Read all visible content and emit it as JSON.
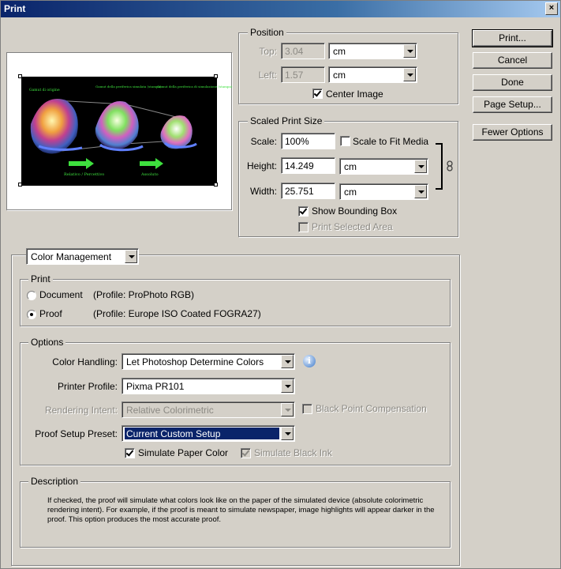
{
  "window": {
    "title": "Print",
    "close_glyph": "×"
  },
  "position": {
    "legend": "Position",
    "top_label": "Top:",
    "top_value": "3.04",
    "top_unit": "cm",
    "left_label": "Left:",
    "left_value": "1.57",
    "left_unit": "cm",
    "center_image_label": "Center Image",
    "center_image_checked": true
  },
  "scaled": {
    "legend": "Scaled Print Size",
    "scale_label": "Scale:",
    "scale_value": "100%",
    "scale_to_fit_label": "Scale to Fit Media",
    "scale_to_fit_checked": false,
    "height_label": "Height:",
    "height_value": "14.249",
    "height_unit": "cm",
    "width_label": "Width:",
    "width_value": "25.751",
    "width_unit": "cm",
    "show_bbox_label": "Show Bounding Box",
    "show_bbox_checked": true,
    "print_selected_label": "Print Selected Area",
    "print_selected_checked": false
  },
  "buttons": {
    "print": "Print...",
    "cancel": "Cancel",
    "done": "Done",
    "page_setup": "Page Setup...",
    "fewer_options": "Fewer Options"
  },
  "preview": {
    "caption_left": "Gamut di origine",
    "caption_mid": "Gamut della periferica simulata (stampa)",
    "caption_right": "Gamut della periferica di simulazione (stampa)",
    "label_relative": "Relativo / Percettivo",
    "label_absolute": "Assoluto"
  },
  "mode_select": "Color Management",
  "print_group": {
    "legend": "Print",
    "document_label": "Document",
    "document_profile": "(Profile: ProPhoto RGB)",
    "proof_label": "Proof",
    "proof_profile": "(Profile: Europe ISO Coated FOGRA27)",
    "selected": "proof"
  },
  "options": {
    "legend": "Options",
    "color_handling_label": "Color Handling:",
    "color_handling_value": "Let Photoshop Determine Colors",
    "printer_profile_label": "Printer Profile:",
    "printer_profile_value": "Pixma PR101",
    "rendering_intent_label": "Rendering Intent:",
    "rendering_intent_value": "Relative Colorimetric",
    "bpc_label": "Black Point Compensation",
    "proof_preset_label": "Proof Setup Preset:",
    "proof_preset_value": "Current Custom Setup",
    "sim_paper_label": "Simulate Paper Color",
    "sim_paper_checked": true,
    "sim_ink_label": "Simulate Black Ink",
    "sim_ink_checked": true
  },
  "description": {
    "legend": "Description",
    "text": "If checked, the proof will simulate what colors look like on the paper of the simulated device (absolute colorimetric rendering intent). For example, if the proof is meant to simulate newspaper, image highlights will appear darker in the proof. This option produces the most accurate proof."
  },
  "colors": {
    "title_bar": "#0a246a",
    "dialog_bg": "#d4d0c8",
    "selection": "#0a246a",
    "preview_bg": "#000000",
    "arrow_green": "#3ee03e"
  }
}
